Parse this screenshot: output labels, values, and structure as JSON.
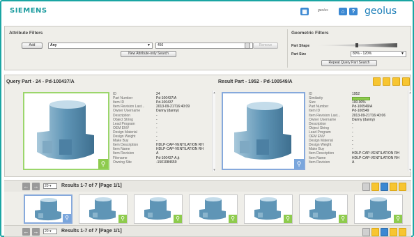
{
  "header": {
    "brand": "SIEMENS",
    "geolus_small": "geolus",
    "geolus_word": "geolus",
    "icons": [
      "book-icon",
      "home-icon",
      "help-icon"
    ]
  },
  "attribute_filters": {
    "title": "Attribute Filters",
    "add_label": "Add",
    "attribute_select": "Any",
    "search_value": "456",
    "remove_label": "Remove",
    "new_search_label": "New Attribute-only Search"
  },
  "geometric_filters": {
    "title": "Geometric Filters",
    "part_shape_label": "Part Shape",
    "part_size_label": "Part Size",
    "part_size_value": "80% - 120%",
    "repeat_label": "Repeat Query Part Search"
  },
  "query_part": {
    "title": "Query Part - 24 - Pd-100437/A",
    "properties": [
      {
        "k": "ID",
        "v": "24"
      },
      {
        "k": "Part Number",
        "v": "Pd-100437/A"
      },
      {
        "k": "Item ID",
        "v": "Pd-100437"
      },
      {
        "k": "Item Revision Last...",
        "v": "2013-09-21T16:40:09"
      },
      {
        "k": "Owner Username",
        "v": "Danny (danny)"
      },
      {
        "k": "Description",
        "v": "-"
      },
      {
        "k": "Object String",
        "v": "-"
      },
      {
        "k": "Lead Program",
        "v": "-"
      },
      {
        "k": "OEM ENV",
        "v": "-"
      },
      {
        "k": "Design Material",
        "v": "-"
      },
      {
        "k": "Design Weight",
        "v": "-"
      },
      {
        "k": "Make Buy",
        "v": "-"
      },
      {
        "k": "Item Description",
        "v": "HDLP-CAP-VENTILATION RH"
      },
      {
        "k": "Item Name",
        "v": "HDLP-CAP-VENTILATION RH"
      },
      {
        "k": "Item Revision",
        "v": "A"
      },
      {
        "k": "Filename",
        "v": "Pd-100437-A.jt"
      },
      {
        "k": "Owning Site",
        "v": "-1501084659"
      }
    ]
  },
  "result_part": {
    "title": "Result Part - 1952 - Pd-100549/A",
    "similarity_pct": 100,
    "properties": [
      {
        "k": "ID",
        "v": "1952"
      },
      {
        "k": "Similarity",
        "v": ""
      },
      {
        "k": "Size",
        "v": "100.00%"
      },
      {
        "k": "Part Number",
        "v": "Pd-100549/A"
      },
      {
        "k": "Item ID",
        "v": "Pd-100549"
      },
      {
        "k": "Item Revision Last...",
        "v": "2013-09-21T16:40:06"
      },
      {
        "k": "Owner Username",
        "v": "Danny (danny)"
      },
      {
        "k": "Description",
        "v": "-"
      },
      {
        "k": "Object String",
        "v": "-"
      },
      {
        "k": "Lead Program",
        "v": "-"
      },
      {
        "k": "OEM ENV",
        "v": "-"
      },
      {
        "k": "Design Material",
        "v": "-"
      },
      {
        "k": "Design Weight",
        "v": "-"
      },
      {
        "k": "Make Buy",
        "v": "-"
      },
      {
        "k": "Item Description",
        "v": "HDLP-CAP-VENTILATION RH"
      },
      {
        "k": "Item Name",
        "v": "HDLP-CAP-VENTILATION RH"
      },
      {
        "k": "Item Revision",
        "v": "A"
      }
    ]
  },
  "results": {
    "page_size": "20",
    "summary": "Results 1-7 of 7 [Page 1/1]",
    "thumbnail_count": 7
  },
  "colors": {
    "accent": "#1aa5a3",
    "green": "#8ecb4d",
    "blue": "#7aa6dc",
    "yellow": "#f7c531"
  }
}
